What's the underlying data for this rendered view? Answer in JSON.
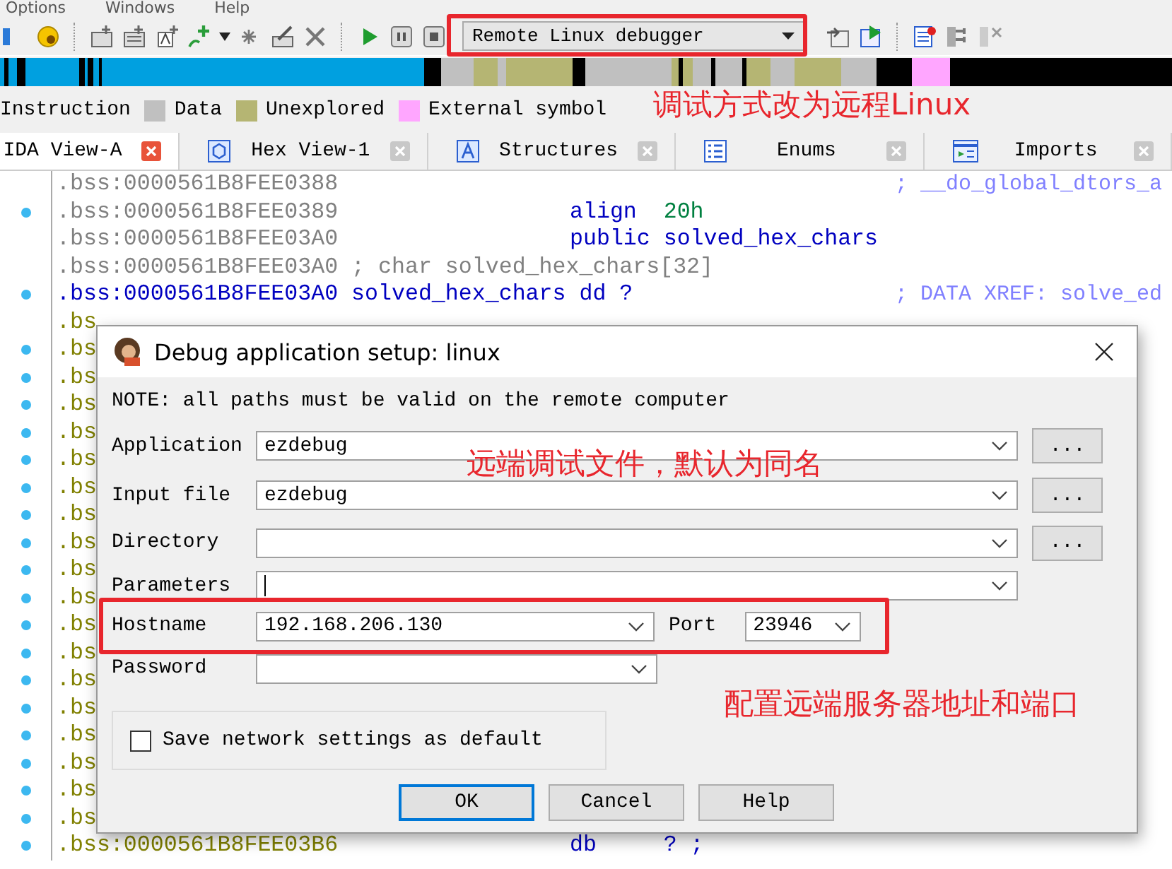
{
  "menu_bar": [
    "Options",
    "Windows",
    "Help"
  ],
  "toolbar": {
    "debugger_select": "Remote Linux debugger"
  },
  "legend": [
    {
      "label": "Instruction"
    },
    {
      "label": "Data",
      "color": "#c0c0c0"
    },
    {
      "label": "Unexplored",
      "color": "#b5b573"
    },
    {
      "label": "External symbol",
      "color": "#ffa6ff"
    }
  ],
  "tabs": [
    {
      "label": "IDA View-A",
      "selected": true
    },
    {
      "label": "Hex View-1",
      "selected": false
    },
    {
      "label": "Structures",
      "selected": false
    },
    {
      "label": "Enums",
      "selected": false
    },
    {
      "label": "Imports",
      "selected": false
    }
  ],
  "listing": [
    {
      "addr": ".bss:0000561B8FEE0388",
      "kind": "line",
      "comment": "; __do_global_dtors_a",
      "dot": false
    },
    {
      "addr": ".bss:0000561B8FEE0389",
      "kind": "line",
      "mnemonic": "align",
      "operand": "20h",
      "operand_is_number": true,
      "dot": true
    },
    {
      "addr": ".bss:0000561B8FEE03A0",
      "kind": "line",
      "mnemonic": "public",
      "operand": "solved_hex_chars",
      "operand_is_number": false,
      "dot": false
    },
    {
      "addr": ".bss:0000561B8FEE03A0",
      "kind": "line",
      "label": "; char solved_hex_chars[32]",
      "dot": false
    },
    {
      "addr": ".bss:0000561B8FEE03A0",
      "kind": "head",
      "label": "solved_hex_chars dd ?",
      "comment": "; DATA XREF: solve_ed",
      "dot": true
    },
    {
      "addr": ".bs",
      "kind": "unexplored",
      "dot": false
    },
    {
      "addr": ".bs",
      "kind": "unexplored",
      "dot": true
    },
    {
      "addr": ".bs",
      "kind": "unexplored",
      "dot": true
    },
    {
      "addr": ".bs",
      "kind": "unexplored",
      "dot": true
    },
    {
      "addr": ".bs",
      "kind": "unexplored",
      "dot": true
    },
    {
      "addr": ".bs",
      "kind": "unexplored",
      "dot": true
    },
    {
      "addr": ".bs",
      "kind": "unexplored",
      "dot": true
    },
    {
      "addr": ".bs",
      "kind": "unexplored",
      "dot": true
    },
    {
      "addr": ".bs",
      "kind": "unexplored",
      "dot": true
    },
    {
      "addr": ".bs",
      "kind": "unexplored",
      "dot": true
    },
    {
      "addr": ".bs",
      "kind": "unexplored",
      "dot": true
    },
    {
      "addr": ".bs",
      "kind": "unexplored",
      "dot": true
    },
    {
      "addr": ".bs",
      "kind": "unexplored",
      "dot": true
    },
    {
      "addr": ".bs",
      "kind": "unexplored",
      "dot": true
    },
    {
      "addr": ".bs",
      "kind": "unexplored",
      "dot": true
    },
    {
      "addr": ".bs",
      "kind": "unexplored",
      "dot": true
    },
    {
      "addr": ".bs",
      "kind": "unexplored",
      "dot": true
    },
    {
      "addr": ".bs",
      "kind": "unexplored",
      "dot": true
    },
    {
      "addr": ".bs",
      "kind": "unexplored",
      "dot": true
    },
    {
      "addr": ".bss:0000561B8FEE03B6",
      "kind": "unexplored",
      "mnemonic": "db",
      "operand": "? ;",
      "operand_is_number": false,
      "dot": true
    }
  ],
  "dialog": {
    "title": "Debug application setup: linux",
    "note": "NOTE: all paths must be valid on the remote computer",
    "fields": [
      {
        "label": "Application",
        "value": "ezdebug",
        "browse": "...",
        "focused": false
      },
      {
        "label": "Input file",
        "value": "ezdebug",
        "browse": "...",
        "focused": false
      },
      {
        "label": "Directory",
        "browse": "...",
        "focused": false
      },
      {
        "label": "Parameters",
        "focused": true
      }
    ],
    "hostname": {
      "label": "Hostname",
      "value": "192.168.206.130"
    },
    "port": {
      "label": "Port",
      "value": "23946"
    },
    "password": {
      "label": "Password"
    },
    "checkbox": {
      "label": "Save network settings as default",
      "checked": false
    },
    "buttons": [
      {
        "label": "OK",
        "default": true
      },
      {
        "label": "Cancel",
        "default": false
      },
      {
        "label": "Help",
        "default": false
      }
    ]
  },
  "annotations": [
    {
      "text": "调试方式改为远程Linux"
    },
    {
      "text": "远端调试文件，默认为同名"
    },
    {
      "text": "配置远端服务器地址和端口"
    }
  ]
}
